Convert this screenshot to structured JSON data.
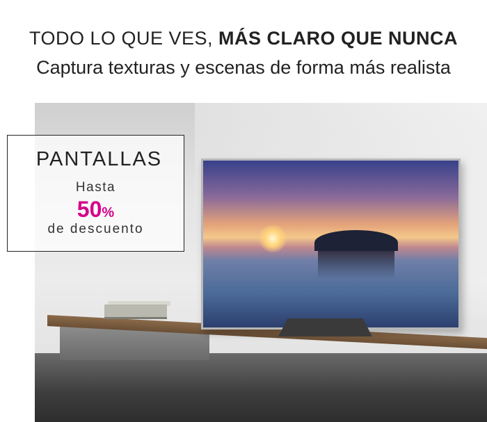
{
  "header": {
    "lead": "TODO LO QUE VES, ",
    "emphasis": "MÁS CLARO QUE NUNCA",
    "subtitle": "Captura texturas y escenas de forma más realista"
  },
  "promo": {
    "title": "PANTALLAS",
    "prefix": "Hasta",
    "value": "50",
    "unit": "%",
    "suffix": "de descuento",
    "accent_color": "#d6008a"
  }
}
